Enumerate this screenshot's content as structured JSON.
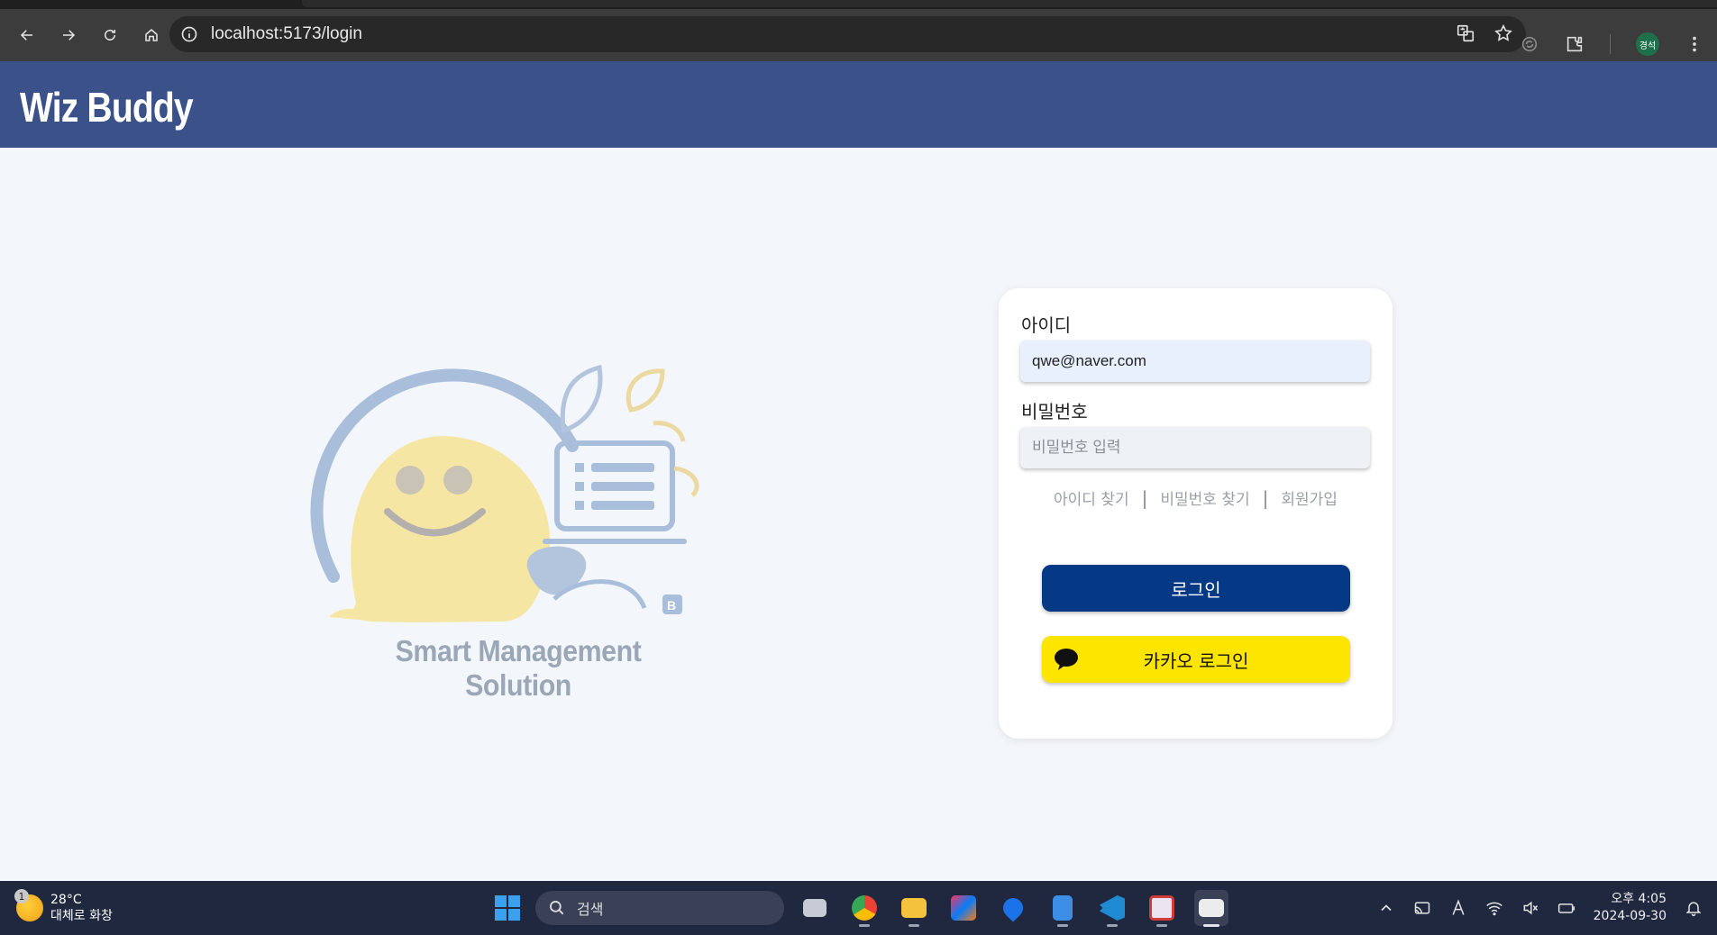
{
  "browser": {
    "url": "localhost:5173/login",
    "profile_initial": "경석"
  },
  "app": {
    "brand": "Wiz Buddy",
    "tagline": "Smart Management Solution"
  },
  "login": {
    "id_label": "아이디",
    "id_value": "qwe@naver.com",
    "password_label": "비밀번호",
    "password_placeholder": "비밀번호 입력",
    "links": {
      "find_id": "아이디 찾기",
      "find_password": "비밀번호 찾기",
      "signup": "회원가입",
      "separator": "|"
    },
    "login_button": "로그인",
    "kakao_button": "카카오 로그인"
  },
  "taskbar": {
    "weather": {
      "temp": "28°C",
      "desc": "대체로 화창",
      "badge": "1"
    },
    "search_placeholder": "검색",
    "clock": {
      "time": "오후 4:05",
      "date": "2024-09-30"
    },
    "apps": [
      "task-view",
      "chrome",
      "file-explorer",
      "intellij",
      "maps",
      "notepad",
      "vscode",
      "snipping-tool",
      "terminal"
    ]
  },
  "colors": {
    "header_bg": "#3a5189",
    "login_button_bg": "#063985",
    "kakao_button_bg": "#fee500",
    "page_bg": "#f3f6fa"
  }
}
